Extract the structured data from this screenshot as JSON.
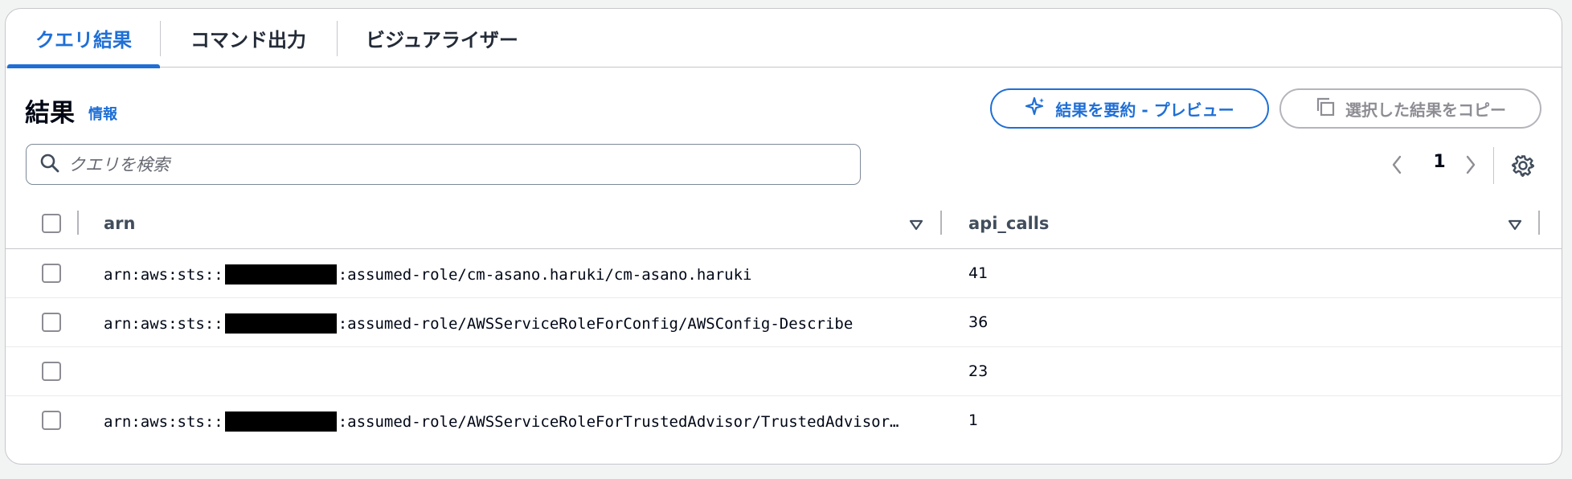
{
  "tabs": [
    {
      "label": "クエリ結果",
      "active": true
    },
    {
      "label": "コマンド出力",
      "active": false
    },
    {
      "label": "ビジュアライザー",
      "active": false
    }
  ],
  "header": {
    "title": "結果",
    "info_link": "情報",
    "summary_button": "結果を要約 - プレビュー",
    "copy_button": "選択した結果をコピー"
  },
  "search": {
    "placeholder": "クエリを検索",
    "value": ""
  },
  "pagination": {
    "current_page": "1"
  },
  "table": {
    "columns": [
      "arn",
      "api_calls"
    ],
    "rows": [
      {
        "arn_prefix": "arn:aws:sts::",
        "arn_suffix": ":assumed-role/cm-asano.haruki/cm-asano.haruki",
        "redacted": true,
        "api_calls": "41"
      },
      {
        "arn_prefix": "arn:aws:sts::",
        "arn_suffix": ":assumed-role/AWSServiceRoleForConfig/AWSConfig-Describe",
        "redacted": true,
        "api_calls": "36"
      },
      {
        "arn_prefix": "",
        "arn_suffix": "",
        "redacted": false,
        "api_calls": "23"
      },
      {
        "arn_prefix": "arn:aws:sts::",
        "arn_suffix": ":assumed-role/AWSServiceRoleForTrustedAdvisor/TrustedAdvisor…",
        "redacted": true,
        "api_calls": "1"
      }
    ]
  },
  "colors": {
    "accent": "#1f6fd6",
    "text": "#000716",
    "border": "#c6c6cd",
    "disabled": "#8d8d94"
  }
}
